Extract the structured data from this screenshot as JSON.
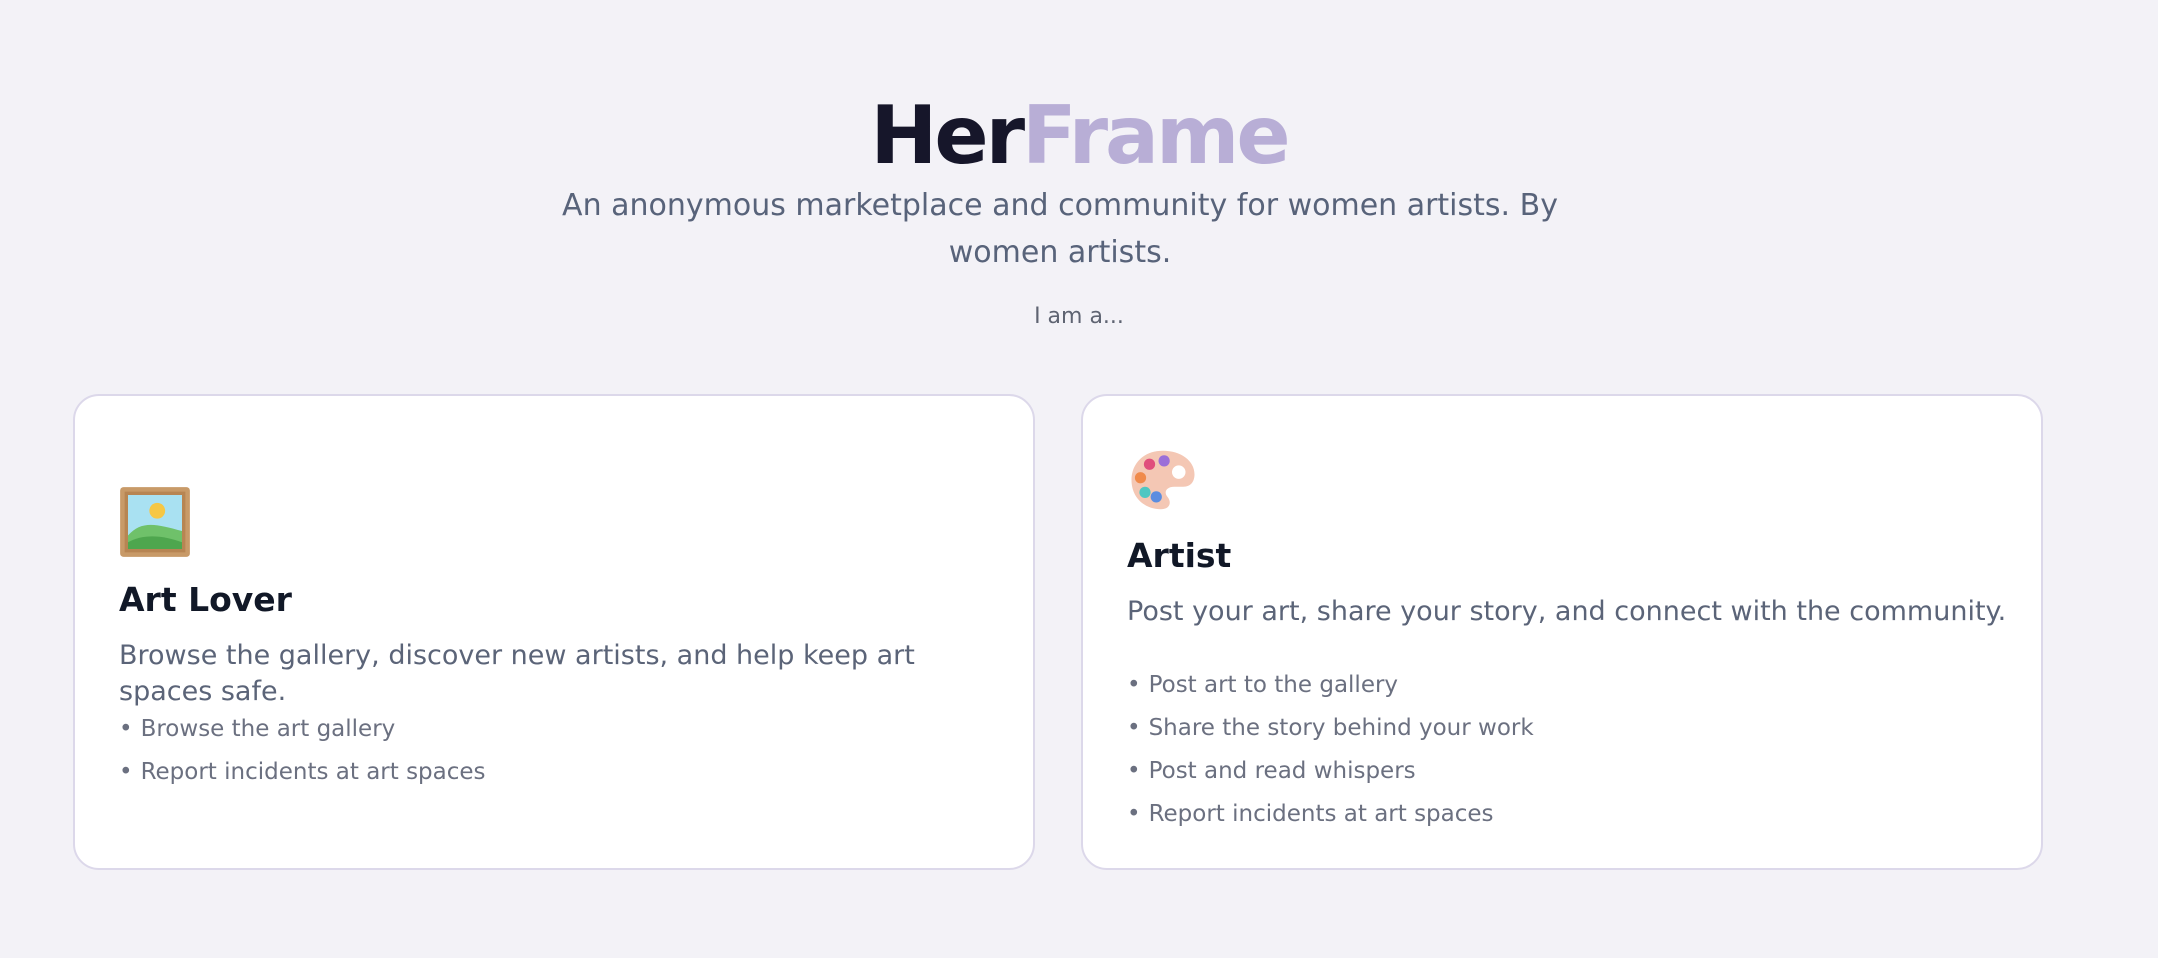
{
  "header": {
    "logo_part1": "Her",
    "logo_part2": "Frame",
    "tagline": "An anonymous marketplace and community for women artists. By women artists.",
    "prompt": "I am a..."
  },
  "roles": [
    {
      "icon": "framed-picture-icon",
      "title": "Art Lover",
      "description": "Browse the gallery, discover new artists, and help keep art spaces safe.",
      "features": [
        "Browse the art gallery",
        "Report incidents at art spaces"
      ]
    },
    {
      "icon": "artist-palette-icon",
      "title": "Artist",
      "description": "Post your art, share your story, and connect with the community.",
      "features": [
        "Post art to the gallery",
        "Share the story behind your work",
        "Post and read whispers",
        "Report incidents at art spaces"
      ]
    }
  ],
  "colors": {
    "background": "#f3f2f7",
    "logo_dark": "#16162a",
    "logo_accent": "#b8aed6",
    "card_border": "#dcd8ea"
  }
}
